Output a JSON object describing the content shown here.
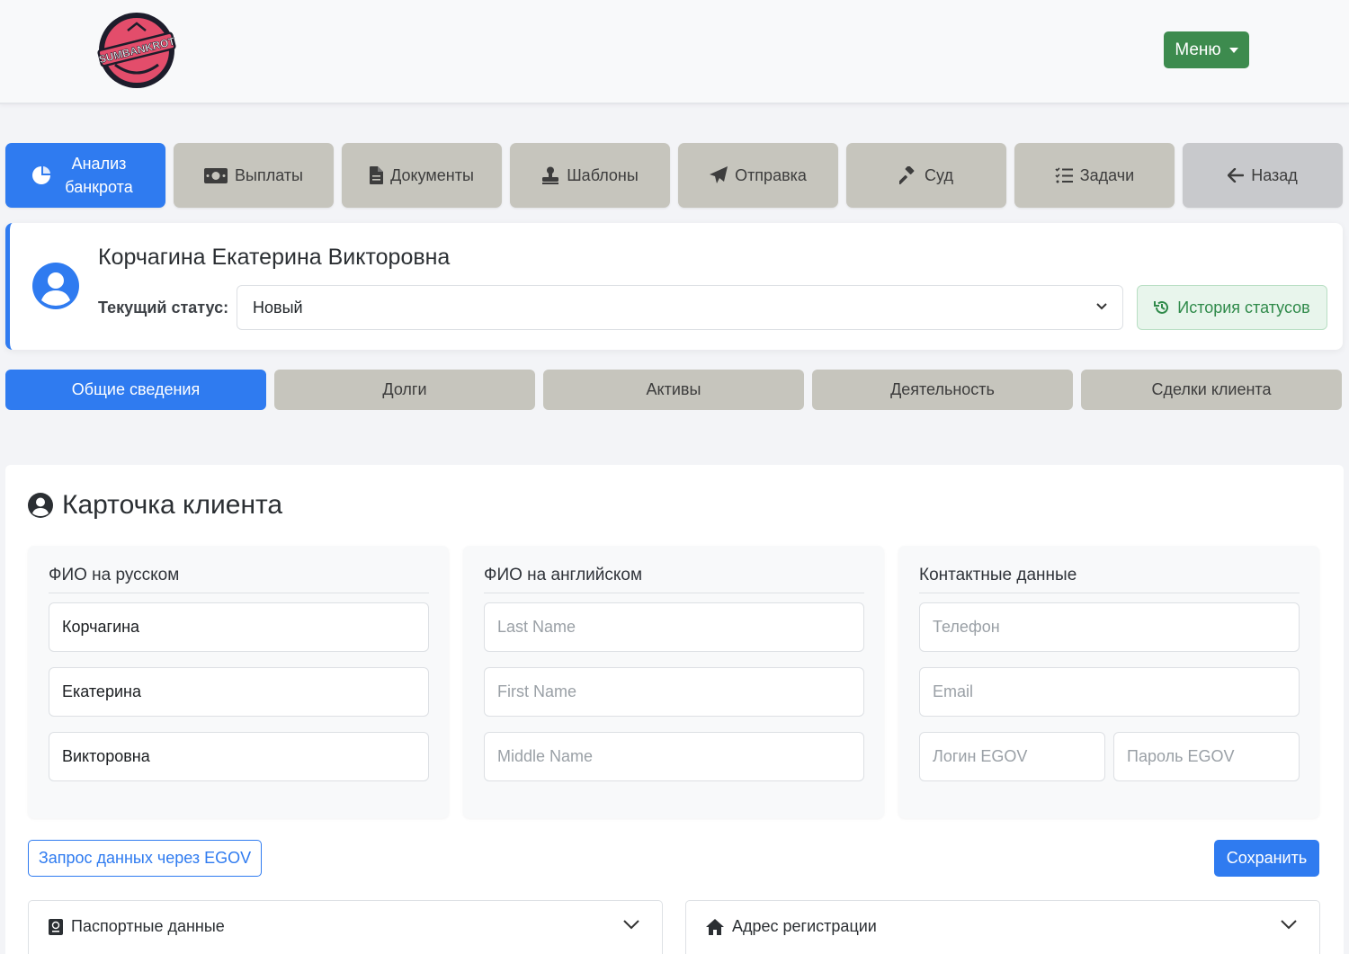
{
  "header": {
    "logo_text": "SUMBANKROT",
    "menu_label": "Меню"
  },
  "nav": {
    "items": [
      {
        "label": "Анализ банкрота",
        "icon": "pie-chart-icon",
        "active": true
      },
      {
        "label": "Выплаты",
        "icon": "money-bill-icon"
      },
      {
        "label": "Документы",
        "icon": "file-icon"
      },
      {
        "label": "Шаблоны",
        "icon": "stamp-icon"
      },
      {
        "label": "Отправка",
        "icon": "paper-plane-icon"
      },
      {
        "label": "Суд",
        "icon": "gavel-icon"
      },
      {
        "label": "Задачи",
        "icon": "tasks-icon"
      },
      {
        "label": "Назад",
        "icon": "arrow-left-icon"
      }
    ]
  },
  "client": {
    "name": "Корчагина Екатерина Викторовна",
    "status_label": "Текущий статус:",
    "status_value": "Новый",
    "history_label": "История статусов"
  },
  "tabs": [
    "Общие сведения",
    "Долги",
    "Активы",
    "Деятельность",
    "Сделки клиента"
  ],
  "card": {
    "title": "Карточка клиента",
    "sections": {
      "ru": {
        "title": "ФИО на русском",
        "last_name": "Корчагина",
        "first_name": "Екатерина",
        "middle_name": "Викторовна"
      },
      "en": {
        "title": "ФИО на английском",
        "last_name_placeholder": "Last Name",
        "first_name_placeholder": "First Name",
        "middle_name_placeholder": "Middle Name"
      },
      "contacts": {
        "title": "Контактные данные",
        "phone_placeholder": "Телефон",
        "email_placeholder": "Email",
        "egov_login_placeholder": "Логин EGOV",
        "egov_password_placeholder": "Пароль EGOV"
      }
    },
    "egov_request_label": "Запрос данных через EGOV",
    "save_label": "Сохранить",
    "accordions": [
      {
        "label": "Паспортные данные",
        "icon": "passport-icon"
      },
      {
        "label": "Адрес регистрации",
        "icon": "home-icon"
      }
    ]
  },
  "colors": {
    "primary": "#2f7bf0",
    "success": "#3d8b4e",
    "nav_inactive": "#c6c5bd"
  }
}
